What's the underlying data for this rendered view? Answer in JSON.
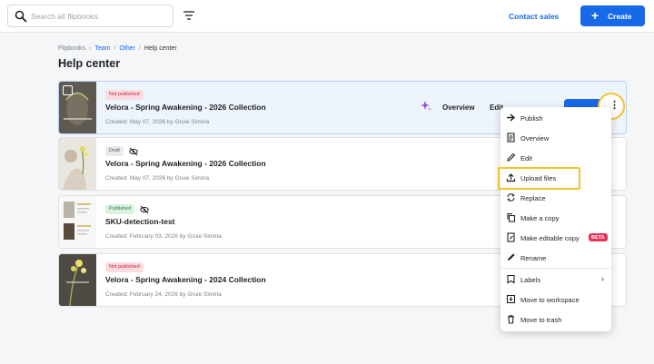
{
  "search": {
    "placeholder": "Search all flipbooks"
  },
  "header": {
    "contact_label": "Contact sales",
    "create_label": "Create"
  },
  "breadcrumb": {
    "items": [
      "Flipbooks",
      "Team",
      "Other",
      "Help center"
    ]
  },
  "page": {
    "title": "Help center"
  },
  "flipbooks": [
    {
      "status": "Not published",
      "title": "Velora - Spring Awakening - 2026 Collection",
      "meta": "Created: May 07, 2026 by Gruie Simina"
    },
    {
      "status": "Draft",
      "title": "Velora - Spring Awakening - 2026 Collection",
      "meta": "Created: May 07, 2026 by Gruie Simina"
    },
    {
      "status": "Published",
      "title": "SKU-detection-test",
      "meta": "Created: February 03, 2026 by Gruie Simina"
    },
    {
      "status": "Not published",
      "title": "Velora - Spring Awakening - 2024 Collection",
      "meta": "Created: February 24, 2026 by Gruie Simina"
    }
  ],
  "row_actions": {
    "overview": "Overview",
    "edit": "Edit"
  },
  "menu": {
    "items": [
      {
        "label": "Publish",
        "icon": "arrow-right-icon"
      },
      {
        "label": "Overview",
        "icon": "document-icon"
      },
      {
        "label": "Edit",
        "icon": "pencil-icon"
      },
      {
        "label": "Upload files",
        "icon": "upload-icon"
      },
      {
        "label": "Replace",
        "icon": "replace-icon"
      },
      {
        "label": "Make a copy",
        "icon": "copy-icon"
      },
      {
        "label": "Make editable copy",
        "icon": "editable-copy-icon",
        "badge": "BETA"
      },
      {
        "label": "Rename",
        "icon": "rename-icon"
      },
      {
        "label": "Labels",
        "icon": "label-icon"
      },
      {
        "label": "Move to workspace",
        "icon": "workspace-icon"
      },
      {
        "label": "Move to trash",
        "icon": "trash-icon"
      }
    ]
  },
  "colors": {
    "accent": "#1769e8",
    "highlight": "#f4c430",
    "beta": "#e2335b"
  }
}
